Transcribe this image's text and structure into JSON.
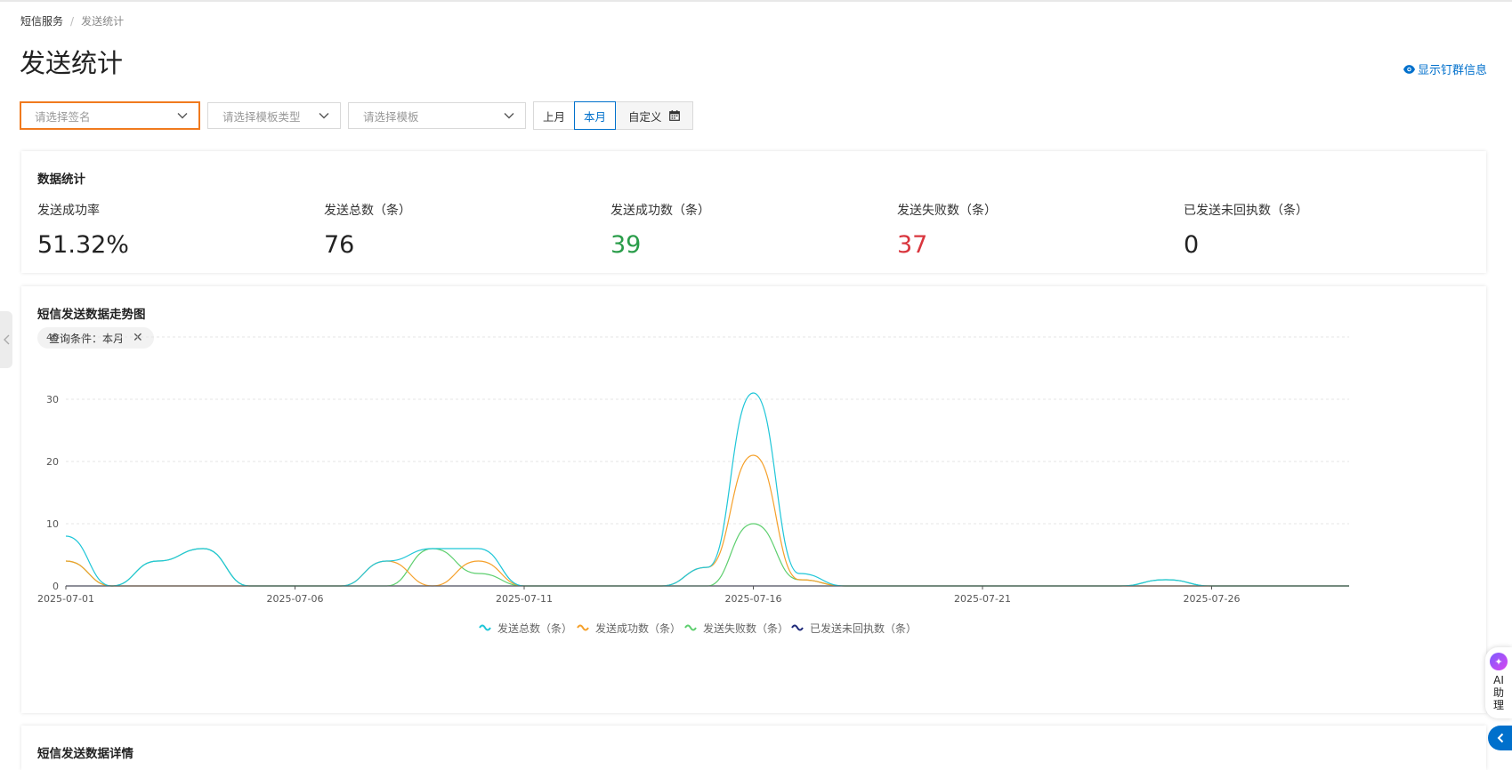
{
  "breadcrumb": {
    "parent": "短信服务",
    "separator": "/",
    "current": "发送统计"
  },
  "page_title": "发送统计",
  "pin_link": "显示钉群信息",
  "filters": {
    "signature_placeholder": "请选择签名",
    "template_type_placeholder": "请选择模板类型",
    "template_placeholder": "请选择模板",
    "last_month": "上月",
    "this_month": "本月",
    "custom": "自定义"
  },
  "stats_card": {
    "title": "数据统计",
    "items": [
      {
        "label": "发送成功率",
        "value": "51.32%"
      },
      {
        "label": "发送总数（条）",
        "value": "76"
      },
      {
        "label": "发送成功数（条）",
        "value": "39"
      },
      {
        "label": "发送失败数（条）",
        "value": "37"
      },
      {
        "label": "已发送未回执数（条）",
        "value": "0"
      }
    ]
  },
  "trend_card": {
    "title": "短信发送数据走势图",
    "tag": "查询条件：本月"
  },
  "details_card": {
    "title": "短信发送数据详情"
  },
  "ai_assistant": {
    "label": "AI助理"
  },
  "colors": {
    "accent": "#0070cc",
    "active_border": "#f07a1e",
    "success": "#2a9d4a",
    "fail": "#d9363e"
  },
  "chart_data": {
    "type": "line",
    "x": [
      "2025-07-01",
      "2025-07-02",
      "2025-07-03",
      "2025-07-04",
      "2025-07-05",
      "2025-07-06",
      "2025-07-07",
      "2025-07-08",
      "2025-07-09",
      "2025-07-10",
      "2025-07-11",
      "2025-07-12",
      "2025-07-13",
      "2025-07-14",
      "2025-07-15",
      "2025-07-16",
      "2025-07-17",
      "2025-07-18",
      "2025-07-19",
      "2025-07-20",
      "2025-07-21",
      "2025-07-22",
      "2025-07-23",
      "2025-07-24",
      "2025-07-25",
      "2025-07-26",
      "2025-07-27",
      "2025-07-28",
      "2025-07-29"
    ],
    "x_tick_labels": [
      "2025-07-01",
      "2025-07-06",
      "2025-07-11",
      "2025-07-16",
      "2025-07-21",
      "2025-07-26"
    ],
    "y_ticks": [
      0,
      10,
      20,
      30,
      40
    ],
    "ylim": [
      0,
      40
    ],
    "grid": true,
    "legend_position": "bottom",
    "series": [
      {
        "name": "发送总数（条）",
        "color": "#1fc6d8",
        "values": [
          8,
          0,
          4,
          6,
          0,
          0,
          0,
          4,
          6,
          6,
          0,
          0,
          0,
          0,
          3,
          31,
          2,
          0,
          0,
          0,
          0,
          0,
          0,
          0,
          1,
          0,
          0,
          0,
          0
        ]
      },
      {
        "name": "发送成功数（条）",
        "color": "#f5a02a",
        "values": [
          4,
          0,
          0,
          0,
          0,
          0,
          0,
          4,
          0,
          4,
          0,
          0,
          0,
          0,
          3,
          21,
          1,
          0,
          0,
          0,
          0,
          0,
          0,
          0,
          0,
          0,
          0,
          0,
          0
        ]
      },
      {
        "name": "发送失败数（条）",
        "color": "#5ecf6f",
        "values": [
          4,
          0,
          4,
          6,
          0,
          0,
          0,
          0,
          6,
          2,
          0,
          0,
          0,
          0,
          0,
          10,
          1,
          0,
          0,
          0,
          0,
          0,
          0,
          0,
          1,
          0,
          0,
          0,
          0
        ]
      },
      {
        "name": "已发送未回执数（条）",
        "color": "#1f2a7a",
        "values": [
          0,
          0,
          0,
          0,
          0,
          0,
          0,
          0,
          0,
          0,
          0,
          0,
          0,
          0,
          0,
          0,
          0,
          0,
          0,
          0,
          0,
          0,
          0,
          0,
          0,
          0,
          0,
          0,
          0
        ]
      }
    ]
  }
}
